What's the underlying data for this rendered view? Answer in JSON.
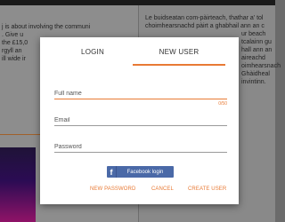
{
  "background": {
    "left_text_lines": [
      "j is about involving the communi",
      ". Give u",
      "the £15,0",
      "rgyll an",
      "ill wide ir"
    ],
    "right_text_lines": [
      "Le buidseatan com-pàirteach, thathar a' tol",
      "choimhearsnachd pàirt a ghabhail ann an c",
      "ur beach",
      "tcalainn gu",
      "hall ann an",
      "aireachd",
      "oimhearsnach",
      "Ghàidheal",
      "invintinn."
    ]
  },
  "modal": {
    "tabs": {
      "login": "LOGIN",
      "new_user": "NEW USER",
      "active": "new_user"
    },
    "fields": {
      "full_name": {
        "placeholder": "Full name",
        "counter": "0/50"
      },
      "email": {
        "placeholder": "Email"
      },
      "password": {
        "placeholder": "Password"
      }
    },
    "facebook": {
      "icon": "f",
      "label": "Facebook login"
    },
    "actions": {
      "new_password": "NEW PASSWORD",
      "cancel": "CANCEL",
      "create_user": "CREATE USER"
    }
  },
  "colors": {
    "accent": "#e87a35",
    "facebook": "#4a69a7"
  }
}
